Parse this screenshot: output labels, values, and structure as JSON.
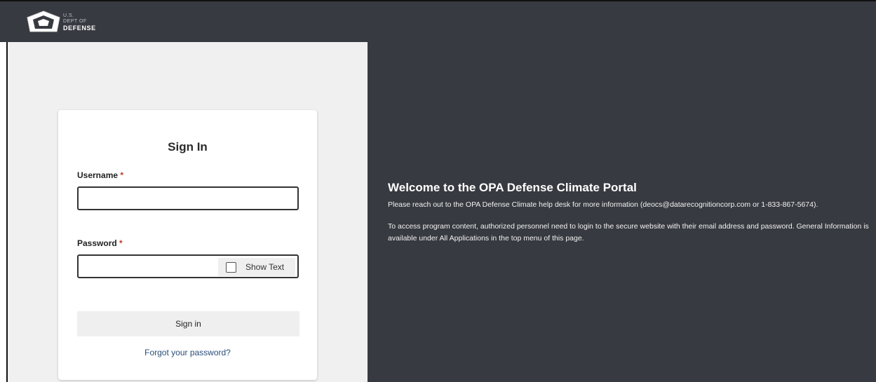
{
  "brand": {
    "logo_line1": "U.S.",
    "logo_line2": "DEPT OF",
    "logo_line3": "DEFENSE"
  },
  "signin": {
    "title": "Sign In",
    "username_label": "Username",
    "password_label": "Password",
    "required_marker": "*",
    "username_value": "",
    "password_value": "",
    "show_text_label": "Show Text",
    "show_text_checked": false,
    "submit_label": "Sign in",
    "forgot_link": "Forgot your password?"
  },
  "welcome": {
    "title": "Welcome to the OPA Defense Climate Portal",
    "paragraph1": "Please reach out to the OPA Defense Climate help desk for more information (deocs@datarecognitioncorp.com or 1-833-867-5674).",
    "paragraph2": "To access program content, authorized personnel need to login to the secure website with their email address and password. General Information is available under All Applications in the top menu of this page."
  },
  "colors": {
    "header_bg": "#373a40",
    "panel_bg": "#f0f0f0",
    "link": "#2a4d7a",
    "required": "#c0392b"
  }
}
